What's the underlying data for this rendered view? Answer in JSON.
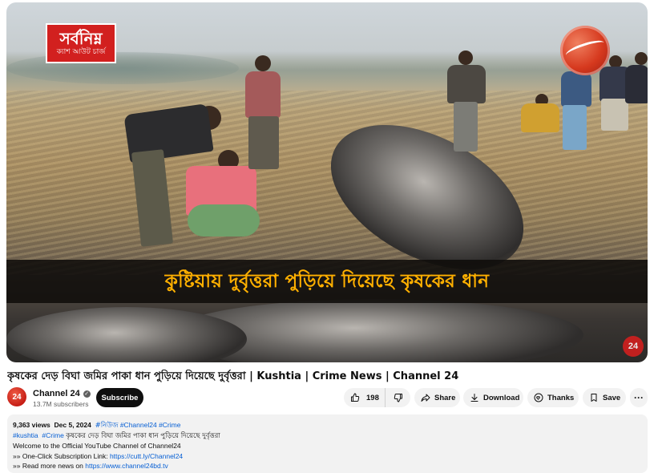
{
  "video": {
    "logo_title": "সর্বনিম্ন",
    "logo_subtitle": "ক্যাশ আউট চার্জ",
    "caption": "কুষ্টিয়ায় দুর্বৃত্তরা পুড়িয়ে দিয়েছে কৃষকের ধান",
    "corner_badge": "24"
  },
  "title": "কৃষকের দেড় বিঘা জমির পাকা ধান পুড়িয়ে দিয়েছে দুর্বৃত্তরা | Kushtia | Crime News | Channel 24",
  "channel": {
    "avatar_text": "24",
    "name": "Channel 24",
    "verified_mark": "✓",
    "subscribers": "13.7M subscribers",
    "subscribe_label": "Subscribe"
  },
  "actions": {
    "like_count": "198",
    "share_label": "Share",
    "download_label": "Download",
    "thanks_label": "Thanks",
    "save_label": "Save",
    "more_label": "···"
  },
  "description": {
    "views": "9,363 views",
    "date": "Dec 5, 2024",
    "hashtags_line1": [
      "#নিউজ",
      "#Channel24",
      "#Crime"
    ],
    "hashtags_line2": [
      "#kushtia",
      "#Crime"
    ],
    "line2_text": "কৃষকের দেড় বিঘা জমির পাকা ধান পুড়িয়ে দিয়েছে দুর্বৃত্তরা",
    "welcome": "Welcome to the Official YouTube Channel of Channel24",
    "sub_link_label": "»» One-Click Subscription Link: ",
    "sub_link": "https://cutt.ly/Channel24",
    "news_label": "»» Read more news on ",
    "news_link": "https://www.channel24bd.tv"
  },
  "icons": {
    "like": "thumbs-up-icon",
    "dislike": "thumbs-down-icon",
    "share": "share-arrow-icon",
    "download": "download-icon",
    "thanks": "thanks-heart-icon",
    "save": "bookmark-icon"
  }
}
